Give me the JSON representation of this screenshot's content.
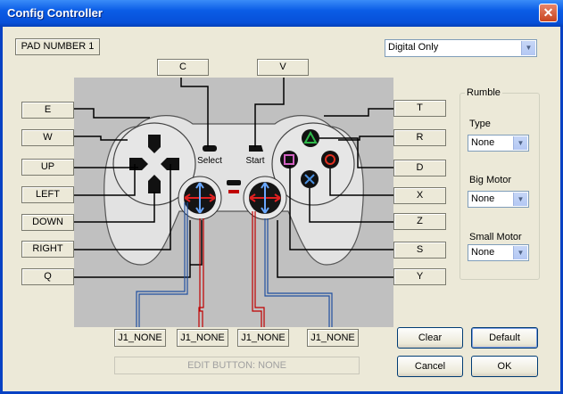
{
  "window": {
    "title": "Config Controller",
    "close_symbol": "✕"
  },
  "pad_label": "PAD NUMBER 1",
  "mode_select": {
    "value": "Digital Only"
  },
  "button_labels": {
    "C": "C",
    "V": "V",
    "E": "E",
    "W": "W",
    "UP": "UP",
    "LEFT": "LEFT",
    "DOWN": "DOWN",
    "RIGHT": "RIGHT",
    "Q": "Q",
    "T": "T",
    "R": "R",
    "D": "D",
    "X": "X",
    "Z": "Z",
    "S": "S",
    "Y": "Y"
  },
  "controller": {
    "select_label": "Select",
    "start_label": "Start"
  },
  "analog_labels": [
    "J1_NONE",
    "J1_NONE",
    "J1_NONE",
    "J1_NONE"
  ],
  "edit_status": "EDIT BUTTON: NONE",
  "rumble": {
    "title": "Rumble",
    "type_label": "Type",
    "type_value": "None",
    "big_motor_label": "Big Motor",
    "big_motor_value": "None",
    "small_motor_label": "Small Motor",
    "small_motor_value": "None"
  },
  "buttons": {
    "clear": "Clear",
    "default": "Default",
    "cancel": "Cancel",
    "ok": "OK"
  },
  "colors": {
    "title_bar": "#0a5ce6",
    "wire_red": "#c00000",
    "wire_blue": "#2050a0",
    "controller_body": "#e0e0e0"
  },
  "icons": {
    "triangle": "triangle-icon",
    "circle": "circle-icon",
    "cross": "cross-icon",
    "square": "square-icon"
  }
}
